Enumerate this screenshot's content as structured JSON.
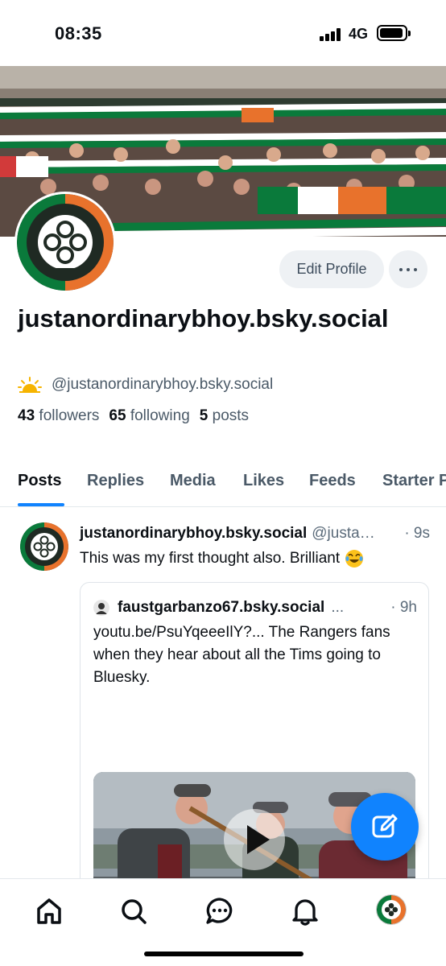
{
  "status_bar": {
    "time": "08:35",
    "network": "4G"
  },
  "profile": {
    "avatar_badge_text": "THE CELTIC FOOTBALL CLUB",
    "avatar_badge_year": "1888",
    "edit_label": "Edit Profile",
    "display_name": "justanordinarybhoy.bsky.social",
    "handle": "@justanordinarybhoy.bsky.social",
    "stats": {
      "followers_count": "43",
      "followers_label": "followers",
      "following_count": "65",
      "following_label": "following",
      "posts_count": "5",
      "posts_label": "posts"
    }
  },
  "tabs": [
    {
      "label": "Posts",
      "active": true
    },
    {
      "label": "Replies"
    },
    {
      "label": "Media"
    },
    {
      "label": "Likes"
    },
    {
      "label": "Feeds"
    },
    {
      "label": "Starter Packs"
    }
  ],
  "post": {
    "author": "justanordinarybhoy.bsky.social",
    "handle": "@justanordinarybhoy.bsky.social",
    "time": "· 9s",
    "text": "This was my first thought also. Brilliant",
    "emoji": "face-with-tears-of-joy",
    "quote": {
      "author": "faustgarbanzo67.bsky.social",
      "dots": "...",
      "time": "· 9h",
      "text": "youtu.be/PsuYqeeeIlY?... The Rangers fans when they hear about all the Tims going to Bluesky."
    }
  },
  "colors": {
    "accent": "#1083fe",
    "celtic_green": "#0a7a3b",
    "irish_orange": "#e8722c"
  },
  "icons": [
    "home-icon",
    "search-icon",
    "chat-icon",
    "bell-icon",
    "compose-icon",
    "play-icon",
    "sun-icon"
  ]
}
